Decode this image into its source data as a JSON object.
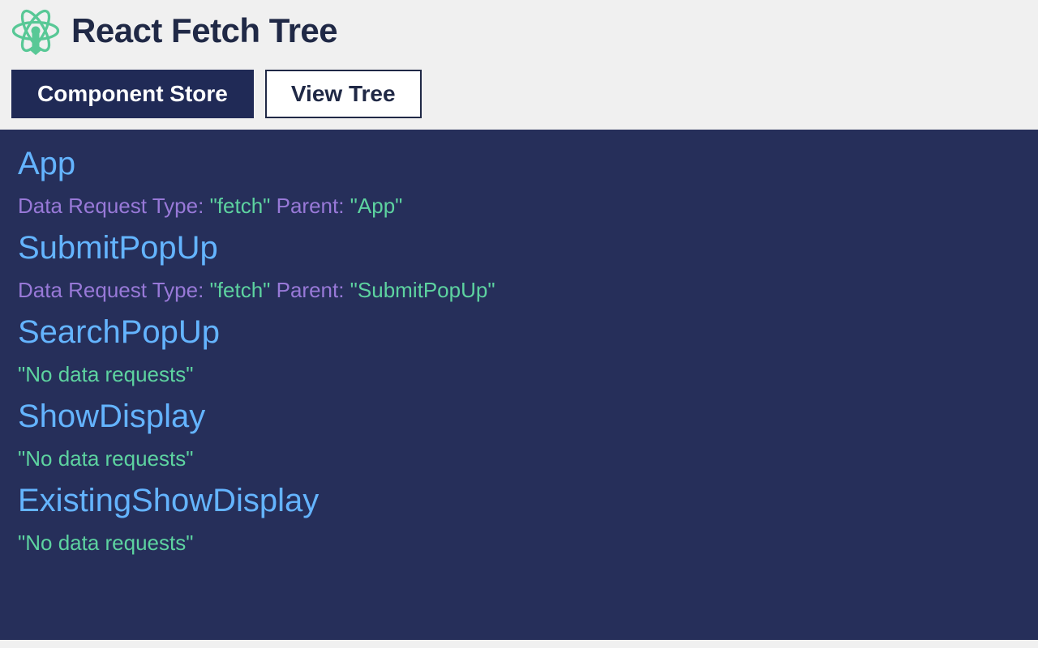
{
  "header": {
    "title": "React Fetch Tree"
  },
  "tabs": {
    "componentStore": "Component Store",
    "viewTree": "View Tree"
  },
  "labels": {
    "dataRequestType": "Data Request Type: ",
    "parent": " Parent: "
  },
  "components": [
    {
      "name": "App",
      "hasRequest": true,
      "requestType": "\"fetch\"",
      "parent": "\"App\""
    },
    {
      "name": "SubmitPopUp",
      "hasRequest": true,
      "requestType": "\"fetch\"",
      "parent": "\"SubmitPopUp\""
    },
    {
      "name": "SearchPopUp",
      "hasRequest": false,
      "noRequestText": "\"No data requests\""
    },
    {
      "name": "ShowDisplay",
      "hasRequest": false,
      "noRequestText": "\"No data requests\""
    },
    {
      "name": "ExistingShowDisplay",
      "hasRequest": false,
      "noRequestText": "\"No data requests\""
    }
  ]
}
